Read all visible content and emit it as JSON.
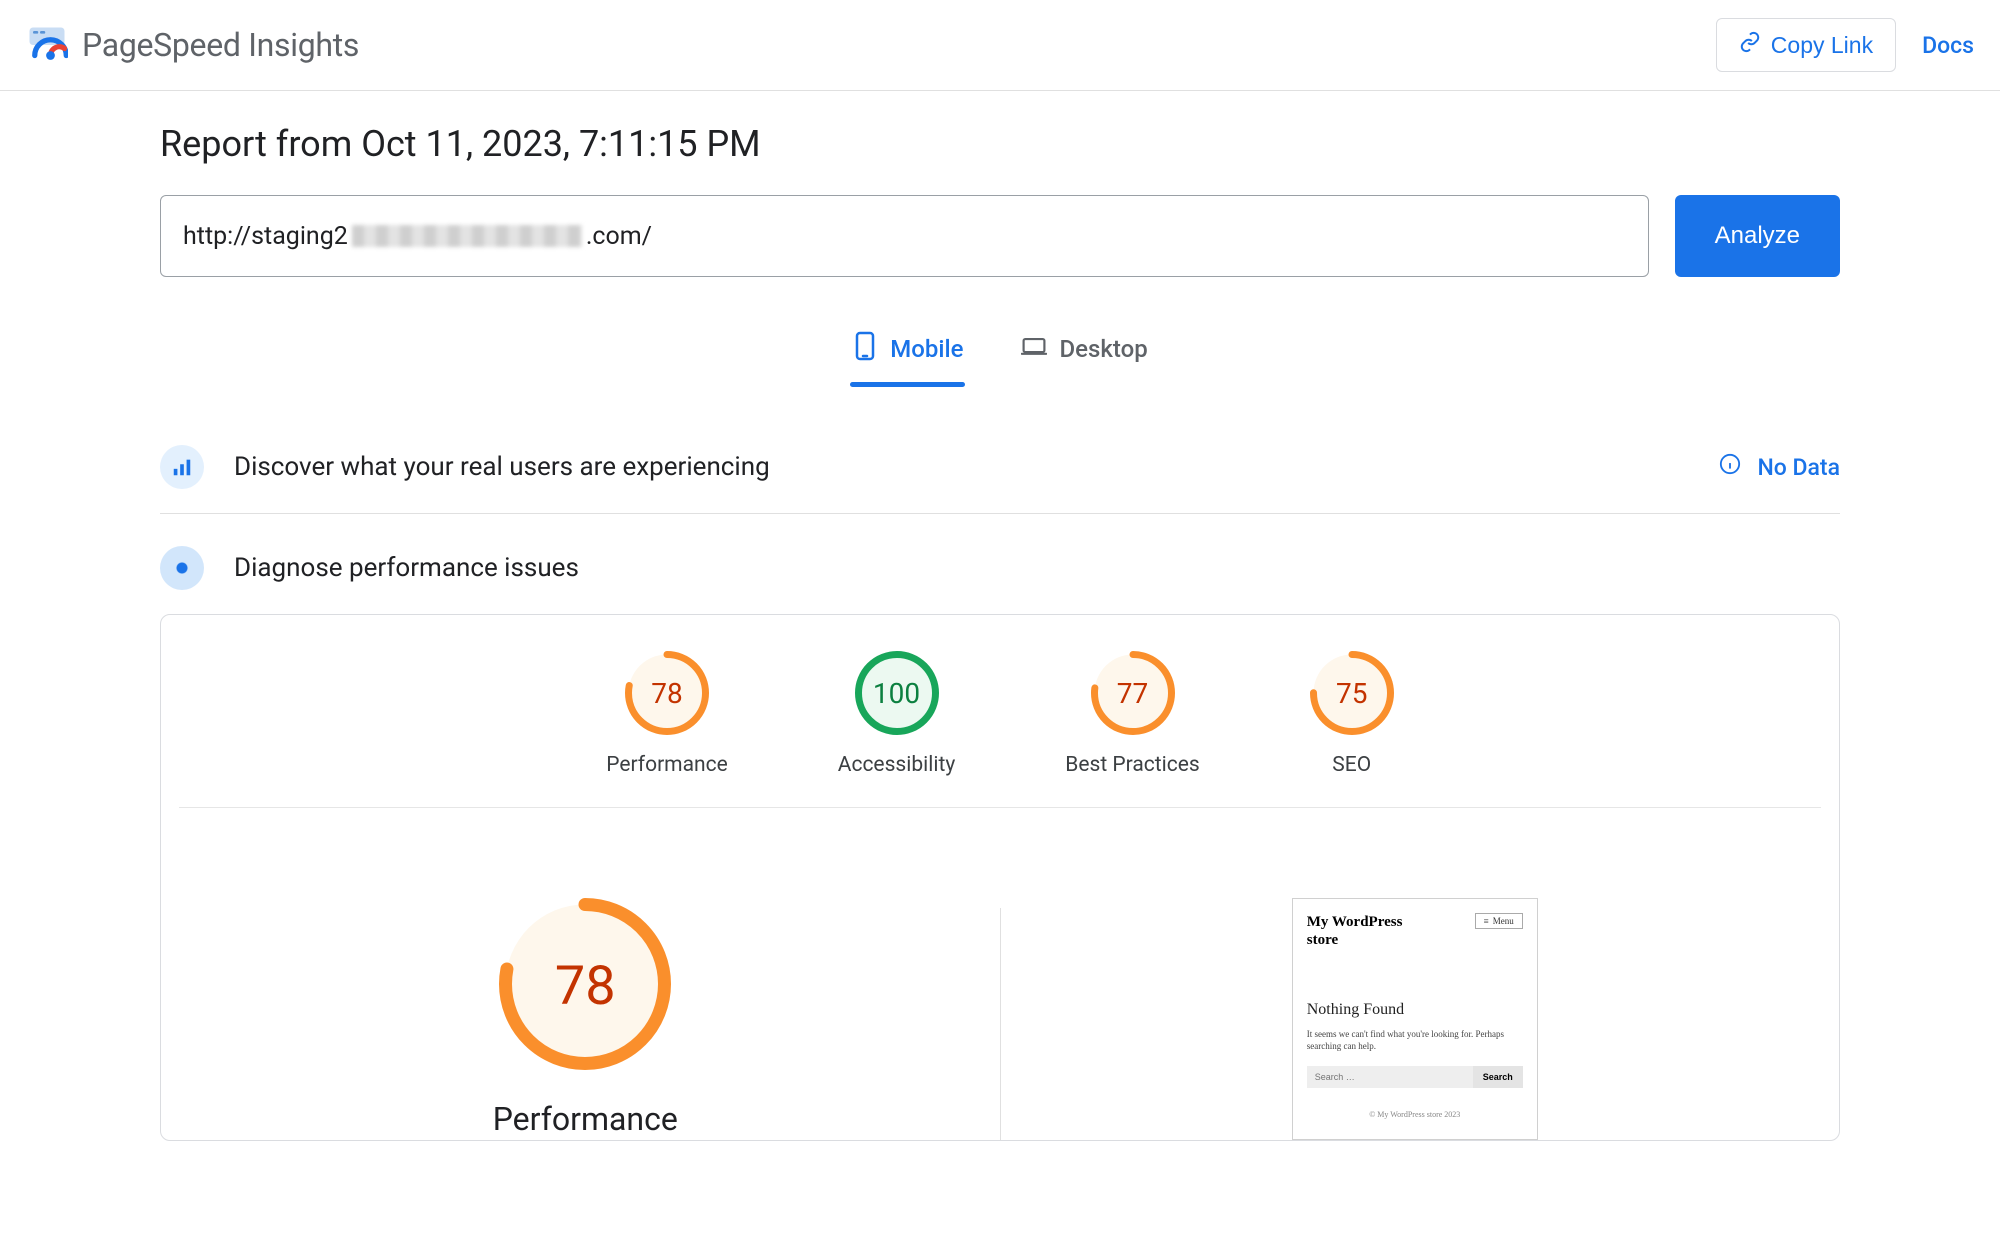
{
  "header": {
    "app_title": "PageSpeed Insights",
    "copy_link_label": "Copy Link",
    "docs_label": "Docs"
  },
  "report": {
    "title": "Report from Oct 11, 2023, 7:11:15 PM",
    "url_prefix": "http://staging2",
    "url_suffix": ".com/",
    "analyze_label": "Analyze"
  },
  "tabs": {
    "mobile": "Mobile",
    "desktop": "Desktop"
  },
  "discover": {
    "title": "Discover what your real users are experiencing",
    "no_data": "No Data"
  },
  "diagnose": {
    "title": "Diagnose performance issues"
  },
  "gauges": [
    {
      "value": "78",
      "label": "Performance",
      "color": "orange",
      "fillColor": "#fef7ec",
      "strokeColor": "#fa8f2c",
      "pct": 78
    },
    {
      "value": "100",
      "label": "Accessibility",
      "color": "green",
      "fillColor": "#ecf9f1",
      "strokeColor": "#18a65a",
      "pct": 100
    },
    {
      "value": "77",
      "label": "Best Practices",
      "color": "orange",
      "fillColor": "#fef7ec",
      "strokeColor": "#fa8f2c",
      "pct": 77
    },
    {
      "value": "75",
      "label": "SEO",
      "color": "orange",
      "fillColor": "#fef7ec",
      "strokeColor": "#fa8f2c",
      "pct": 75
    }
  ],
  "big_gauge": {
    "value": "78",
    "label": "Performance",
    "fillColor": "#fef7ec",
    "strokeColor": "#fa8f2c",
    "pct": 78
  },
  "preview": {
    "site_title": "My WordPress store",
    "menu_label": "Menu",
    "heading": "Nothing Found",
    "text": "It seems we can't find what you're looking for. Perhaps searching can help.",
    "search_placeholder": "Search …",
    "search_btn": "Search",
    "footer": "© My WordPress store 2023"
  }
}
